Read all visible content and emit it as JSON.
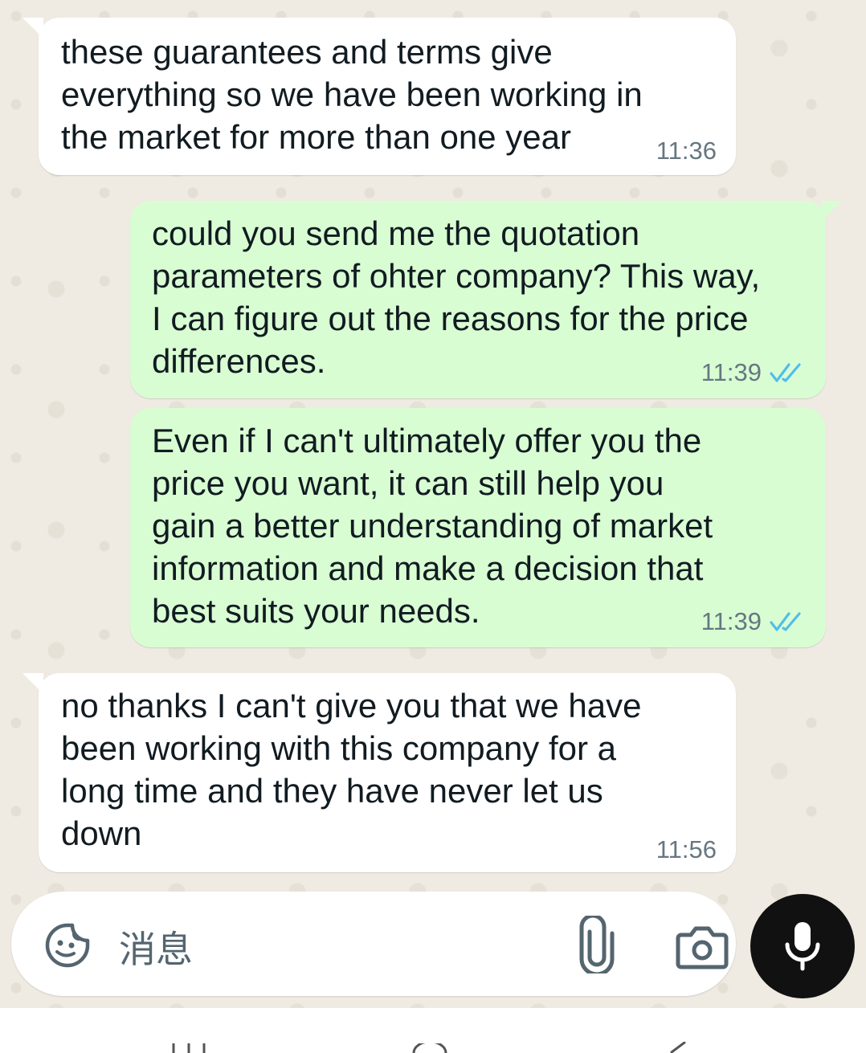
{
  "messages": [
    {
      "direction": "incoming",
      "text": "these guarantees and terms give\neverything so we have been working in\nthe market for more than one year",
      "time": "11:36"
    },
    {
      "direction": "outgoing",
      "text": "could you send me the quotation\nparameters of ohter company? This way,\nI can figure out the reasons for the price\ndifferences.",
      "time": "11:39",
      "status_icon": "double-check-read-icon"
    },
    {
      "direction": "outgoing",
      "text": "Even if I can't ultimately offer you the\nprice you want, it can still help you\ngain a better understanding of market\ninformation and make a decision that\nbest suits your needs.",
      "time": "11:39",
      "status_icon": "double-check-read-icon"
    },
    {
      "direction": "incoming",
      "text": "no thanks I can't give you that we have\nbeen working with this company for a\nlong time and they have never let us\ndown",
      "time": "11:56"
    }
  ],
  "composer": {
    "placeholder": "消息",
    "left_icon": "sticker-icon",
    "attach_icon": "paperclip-icon",
    "camera_icon": "camera-icon",
    "send_icon": "microphone-icon"
  },
  "colors": {
    "chat_background": "#efeae2",
    "incoming_bubble": "#ffffff",
    "outgoing_bubble": "#d9fdd3",
    "read_ticks": "#53bdeb",
    "mic_button": "#111111"
  },
  "nav": {
    "buttons": [
      "recent-apps-icon",
      "home-icon",
      "back-icon"
    ]
  }
}
